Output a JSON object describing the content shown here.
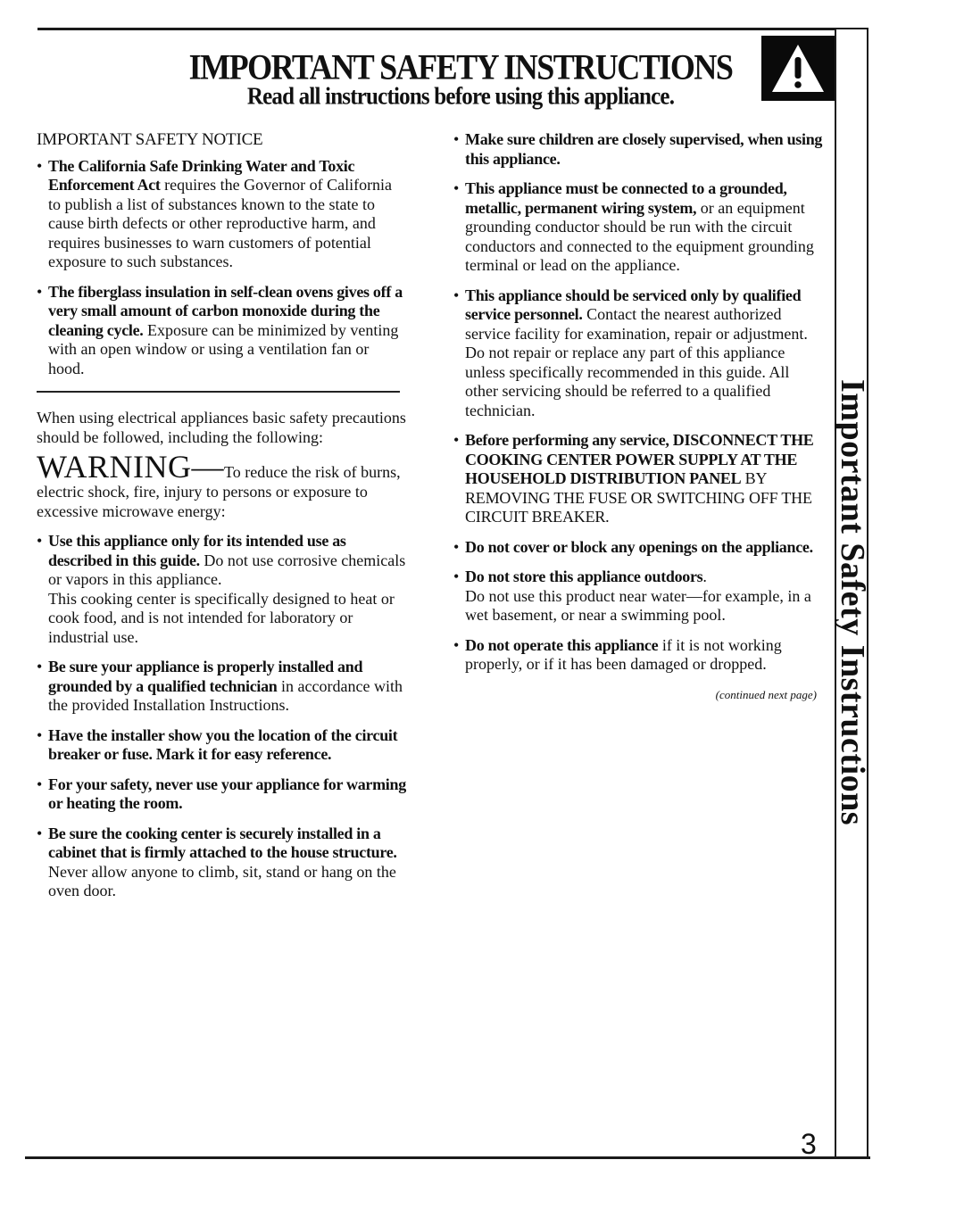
{
  "header": {
    "title": "IMPORTANT SAFETY INSTRUCTIONS",
    "subtitle": "Read all instructions before using this appliance.",
    "icon": "warning-triangle-icon"
  },
  "side_tab": {
    "label": "Important Safety Instructions"
  },
  "page_number": "3",
  "left_column": {
    "notice_heading": "IMPORTANT SAFETY NOTICE",
    "notice_items": [
      {
        "bold": "The California Safe Drinking Water and Toxic Enforcement Act",
        "text": " requires the Governor of California to publish a list of substances known to the state to cause birth defects or other reproductive harm, and requires businesses to warn customers of potential exposure to such substances."
      },
      {
        "bold": "The fiberglass insulation in self-clean ovens gives off a very small amount of carbon monoxide during the cleaning cycle.",
        "text": " Exposure can be minimized by venting with an open window or using a ventilation fan or hood."
      }
    ],
    "intro": "When using electrical appliances basic safety precautions should be followed, including the following:",
    "warning_word": "WARNING—",
    "warning_text": "To reduce the risk of burns, electric shock, fire, injury to persons or exposure to excessive microwave energy:",
    "items": [
      {
        "bold": "Use this appliance only for its intended use as described in this guide.",
        "text": " Do not use corrosive chemicals or vapors in this appliance.",
        "extra": "This cooking center is specifically designed to heat or cook food, and is not intended for laboratory or industrial use."
      },
      {
        "bold": "Be sure your appliance is properly installed and grounded by a qualified technician",
        "text": " in accordance with the provided Installation Instructions."
      },
      {
        "bold": "Have the installer show you the location of the circuit breaker or fuse. Mark it for easy reference.",
        "text": ""
      },
      {
        "bold": "For your safety, never use your appliance for warming or heating the room.",
        "text": ""
      },
      {
        "bold": "Be sure the cooking center is securely installed in a cabinet that is firmly attached to the house structure.",
        "text": " Never allow anyone to climb, sit, stand or hang on the oven door."
      }
    ]
  },
  "right_column": {
    "items": [
      {
        "bold": "Make sure children are closely supervised, when using this appliance.",
        "text": ""
      },
      {
        "bold": "This appliance must be connected to a grounded, metallic, permanent wiring system,",
        "text": " or an equipment grounding conductor should be run with the circuit conductors and connected to the equipment grounding terminal or lead on the appliance."
      },
      {
        "bold": "This appliance should be serviced only by qualified service personnel.",
        "text": " Contact the nearest authorized service facility for examination, repair or adjustment. Do not repair or replace any part of this appliance unless specifically recommended in this guide. All other servicing should be referred to a qualified technician."
      },
      {
        "bold": "Before performing any service, DISCONNECT THE COOKING CENTER POWER SUPPLY AT THE HOUSEHOLD DISTRIBUTION PANEL",
        "text": " BY REMOVING THE FUSE OR SWITCHING OFF THE CIRCUIT BREAKER."
      },
      {
        "bold": "Do not cover or block any openings on the appliance.",
        "text": ""
      },
      {
        "bold": "Do not store this appliance outdoors",
        "text": ".",
        "extra": "Do not use this product near water—for example, in a wet basement, or near a swimming pool."
      },
      {
        "bold": "Do not operate this appliance",
        "text": " if it is not working properly, or if it has been damaged or dropped."
      }
    ],
    "continued": "(continued next page)"
  }
}
